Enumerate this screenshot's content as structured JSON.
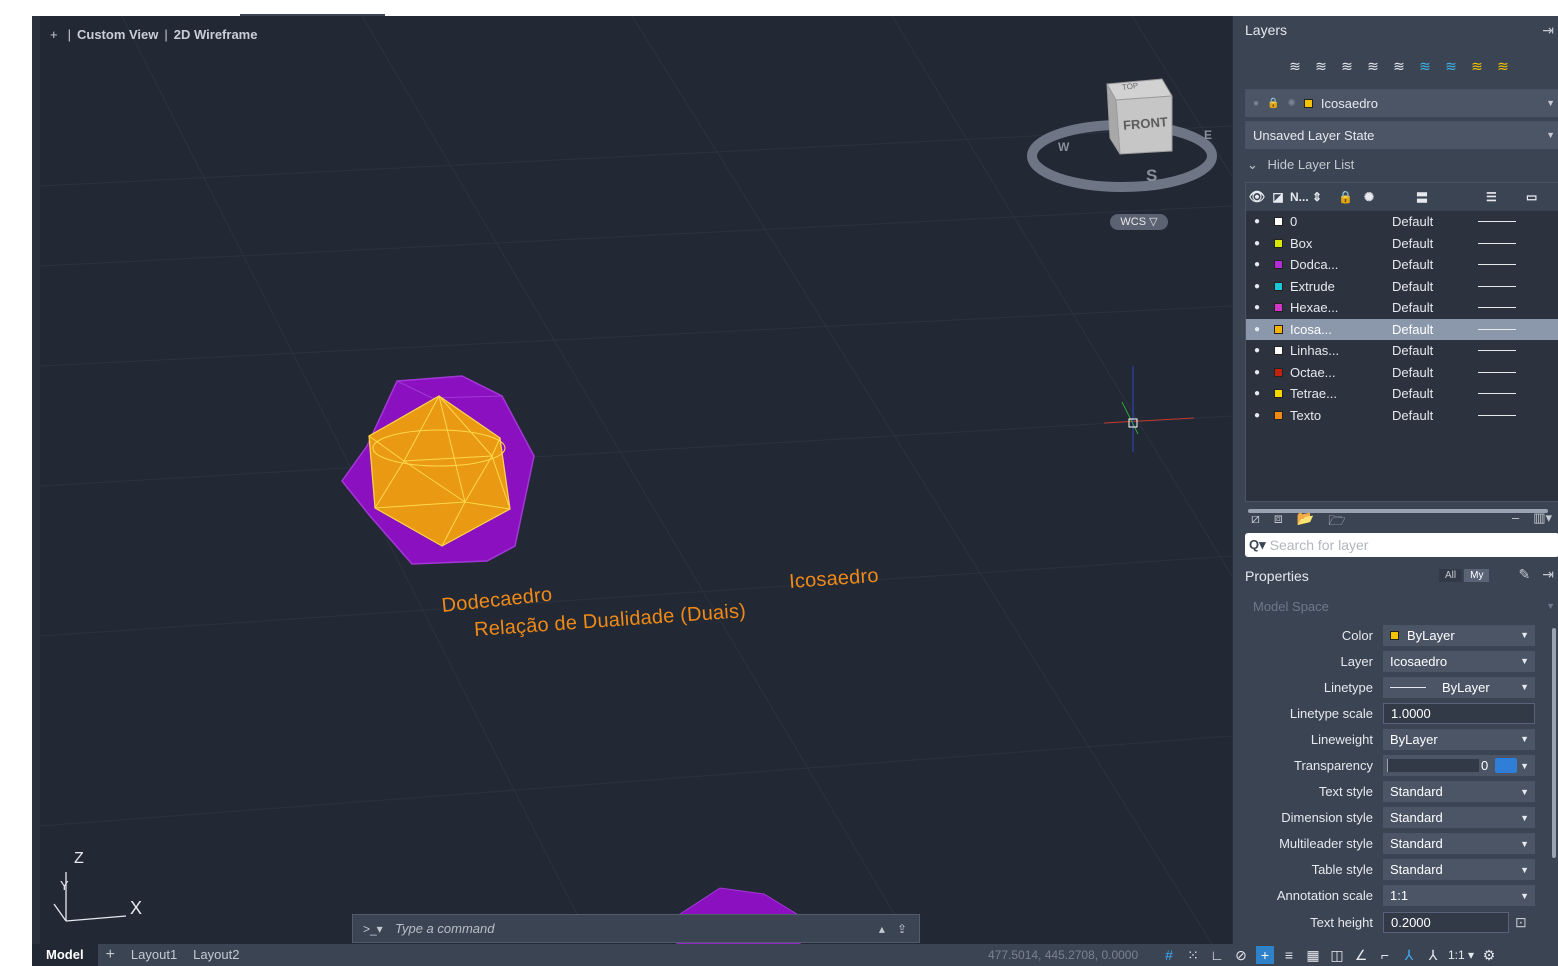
{
  "viewport": {
    "view_controls": {
      "plus": "+",
      "view": "Custom View",
      "visual_style": "2D Wireframe"
    },
    "model_texts": {
      "dodecaedro": "Dodecaedro",
      "icosaedro": "Icosaedro",
      "relacao": "Relação de Dualidade (Duais)"
    },
    "viewcube": {
      "face": "FRONT",
      "top_face": "TOP",
      "compass": {
        "w": "W",
        "e": "E",
        "s": "S"
      }
    },
    "wcs": "WCS ▽",
    "ucs": {
      "z": "Z",
      "y": "Y",
      "x": "X"
    }
  },
  "command_line": {
    "prompt": ">_▾",
    "placeholder": "Type a command"
  },
  "statusbar": {
    "tabs": [
      {
        "label": "Model",
        "active": true
      },
      {
        "label": "+"
      },
      {
        "label": "Layout1"
      },
      {
        "label": "Layout2"
      }
    ],
    "coordinates": "477.5014, 445.2708, 0.0000",
    "annotation_scale": "1:1 ▾"
  },
  "layers_panel": {
    "title": "Layers",
    "current_layer": "Icosaedro",
    "current_layer_color": "#f5c400",
    "layer_state": "Unsaved Layer State",
    "hide_list_label": "Hide Layer List",
    "header": {
      "name": "N... ⇕"
    },
    "layers": [
      {
        "name": "0",
        "linetype": "Default",
        "color": "#ffffff"
      },
      {
        "name": "Box",
        "linetype": "Default",
        "color": "#d7e800"
      },
      {
        "name": "Dodca...",
        "linetype": "Default",
        "color": "#b22bd8"
      },
      {
        "name": "Extrude",
        "linetype": "Default",
        "color": "#19c7d6"
      },
      {
        "name": "Hexae...",
        "linetype": "Default",
        "color": "#d436c8"
      },
      {
        "name": "Icosa...",
        "linetype": "Default",
        "color": "#f5b400",
        "selected": true
      },
      {
        "name": "Linhas...",
        "linetype": "Default",
        "color": "#ffffff"
      },
      {
        "name": "Octae...",
        "linetype": "Default",
        "color": "#c0220f"
      },
      {
        "name": "Tetrae...",
        "linetype": "Default",
        "color": "#f5d800"
      },
      {
        "name": "Texto",
        "linetype": "Default",
        "color": "#ef8a17"
      }
    ],
    "search_placeholder": "Search for layer"
  },
  "properties_panel": {
    "title": "Properties",
    "toggle": {
      "all": "All",
      "my": "My"
    },
    "context": "Model Space",
    "rows": [
      {
        "label": "Color",
        "value": "ByLayer"
      },
      {
        "label": "Layer",
        "value": "Icosaedro"
      },
      {
        "label": "Linetype",
        "value": "ByLayer"
      },
      {
        "label": "Linetype scale",
        "value": "1.0000"
      },
      {
        "label": "Lineweight",
        "value": "ByLayer"
      },
      {
        "label": "Transparency",
        "value": "0"
      },
      {
        "label": "Text style",
        "value": "Standard"
      },
      {
        "label": "Dimension style",
        "value": "Standard"
      },
      {
        "label": "Multileader style",
        "value": "Standard"
      },
      {
        "label": "Table style",
        "value": "Standard"
      },
      {
        "label": "Annotation scale",
        "value": "1:1"
      },
      {
        "label": "Text height",
        "value": "0.2000"
      }
    ]
  },
  "colors": {
    "accent": "#2f81c8",
    "model_text": "#ef8a17",
    "dodecahedron": "#8b10c0",
    "icosahedron": "#f1a400"
  }
}
